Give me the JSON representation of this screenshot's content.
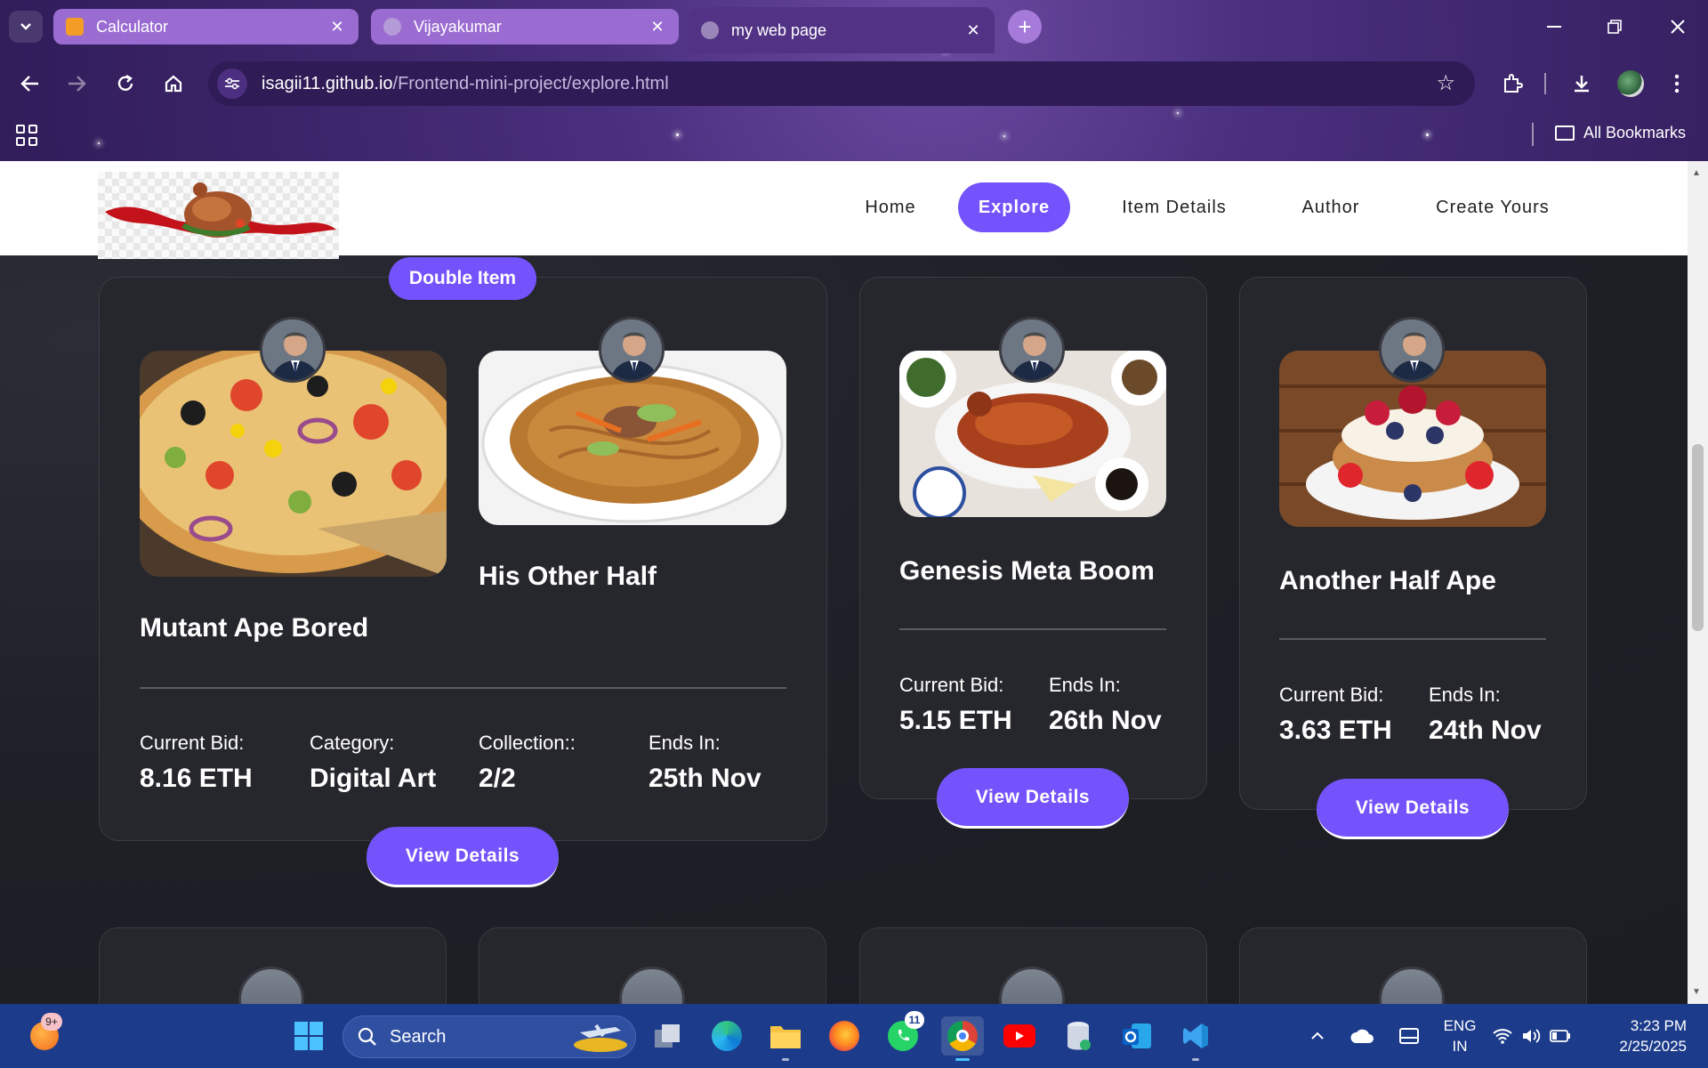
{
  "browser": {
    "tabs": [
      {
        "label": "Calculator",
        "state": "inactive"
      },
      {
        "label": "Vijayakumar",
        "state": "inactive"
      },
      {
        "label": "my web page",
        "state": "active"
      }
    ],
    "tab_close_glyph": "✕",
    "new_tab_glyph": "+",
    "address": {
      "host": "isagii11.github.io",
      "path": "/Frontend-mini-project/explore.html"
    },
    "bookmarks_folder": "All Bookmarks"
  },
  "site": {
    "nav": [
      {
        "label": "Home",
        "active": false
      },
      {
        "label": "Explore",
        "active": true
      },
      {
        "label": "Item Details",
        "active": false
      },
      {
        "label": "Author",
        "active": false
      },
      {
        "label": "Create Yours",
        "active": false
      }
    ],
    "double_card": {
      "badge": "Double Item",
      "items": [
        {
          "title": "Mutant Ape Bored",
          "image": "pizza"
        },
        {
          "title": "His Other Half",
          "image": "noodles"
        }
      ],
      "stats": [
        {
          "label": "Current Bid:",
          "value": "8.16 ETH"
        },
        {
          "label": "Category:",
          "value": "Digital Art"
        },
        {
          "label": "Collection::",
          "value": "2/2"
        },
        {
          "label": "Ends In:",
          "value": "25th Nov"
        }
      ],
      "button": "View Details"
    },
    "cards": [
      {
        "title": "Genesis Meta Boom",
        "image": "roast-duck",
        "bid_label": "Current Bid:",
        "bid": "5.15 ETH",
        "ends_label": "Ends In:",
        "ends": "26th Nov",
        "button": "View Details"
      },
      {
        "title": "Another Half Ape",
        "image": "berry-pancakes",
        "bid_label": "Current Bid:",
        "bid": "3.63 ETH",
        "ends_label": "Ends In:",
        "ends": "24th Nov",
        "button": "View Details"
      }
    ],
    "accent_color": "#7453fc"
  },
  "taskbar": {
    "weather_badge": "9+",
    "search_placeholder": "Search",
    "whatsapp_badge": "11",
    "lang_line1": "ENG",
    "lang_line2": "IN",
    "time": "3:23 PM",
    "date": "2/25/2025"
  }
}
